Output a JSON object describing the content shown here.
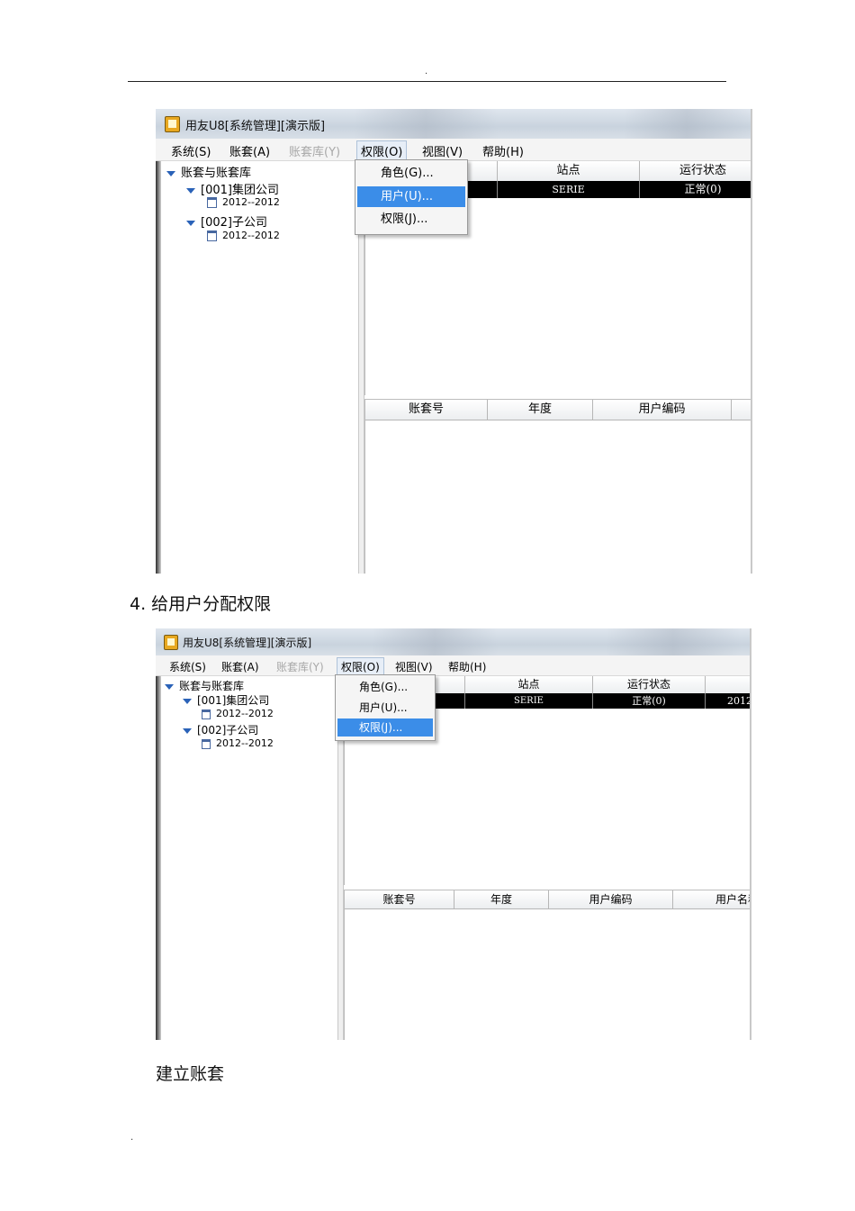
{
  "header": {
    "dot": "."
  },
  "footer": {
    "dot": "."
  },
  "shot1": {
    "window_title": "用友U8[系统管理][演示版]",
    "menu": [
      {
        "label": "系统(S)",
        "state": "normal"
      },
      {
        "label": "账套(A)",
        "state": "normal"
      },
      {
        "label": "账套库(Y)",
        "state": "disabled"
      },
      {
        "label": "权限(O)",
        "state": "active"
      },
      {
        "label": "视图(V)",
        "state": "normal"
      },
      {
        "label": "帮助(H)",
        "state": "normal"
      }
    ],
    "tree": [
      {
        "label": "账套与账套库",
        "kind": "expanded"
      },
      {
        "label": "[001]集团公司",
        "kind": "expanded"
      },
      {
        "label": "2012--2012",
        "kind": "year"
      },
      {
        "label": "[002]子公司",
        "kind": "expanded"
      },
      {
        "label": "2012--2012",
        "kind": "year"
      }
    ],
    "top_headers": [
      "站点",
      "运行状态"
    ],
    "top_row": [
      "SERIE",
      "正常(0)"
    ],
    "bottom_headers": [
      "账套号",
      "年度",
      "用户编码"
    ],
    "popup": [
      {
        "label": "角色(G)...",
        "selected": false
      },
      {
        "label": "用户(U)...",
        "selected": true
      },
      {
        "label": "权限(J)...",
        "selected": false
      }
    ]
  },
  "step4": {
    "caption": "4.  给用户分配权限"
  },
  "shot2": {
    "window_title": "用友U8[系统管理][演示版]",
    "menu": [
      {
        "label": "系统(S)",
        "state": "normal"
      },
      {
        "label": "账套(A)",
        "state": "normal"
      },
      {
        "label": "账套库(Y)",
        "state": "disabled"
      },
      {
        "label": "权限(O)",
        "state": "active"
      },
      {
        "label": "视图(V)",
        "state": "normal"
      },
      {
        "label": "帮助(H)",
        "state": "normal"
      }
    ],
    "tree": [
      {
        "label": "账套与账套库",
        "kind": "expanded"
      },
      {
        "label": "[001]集团公司",
        "kind": "expanded"
      },
      {
        "label": "2012--2012",
        "kind": "year"
      },
      {
        "label": "[002]子公司",
        "kind": "expanded"
      },
      {
        "label": "2012--2012",
        "kind": "year"
      }
    ],
    "top_headers": [
      "站点",
      "运行状态",
      ""
    ],
    "top_row": [
      "SERIE",
      "正常(0)",
      "2012"
    ],
    "bottom_headers": [
      "账套号",
      "年度",
      "用户编码",
      "用户名称"
    ],
    "popup": [
      {
        "label": "角色(G)...",
        "selected": false
      },
      {
        "label": "用户(U)...",
        "selected": false
      },
      {
        "label": "权限(J)...",
        "selected": true
      }
    ]
  },
  "closing": {
    "caption": "建立账套"
  }
}
